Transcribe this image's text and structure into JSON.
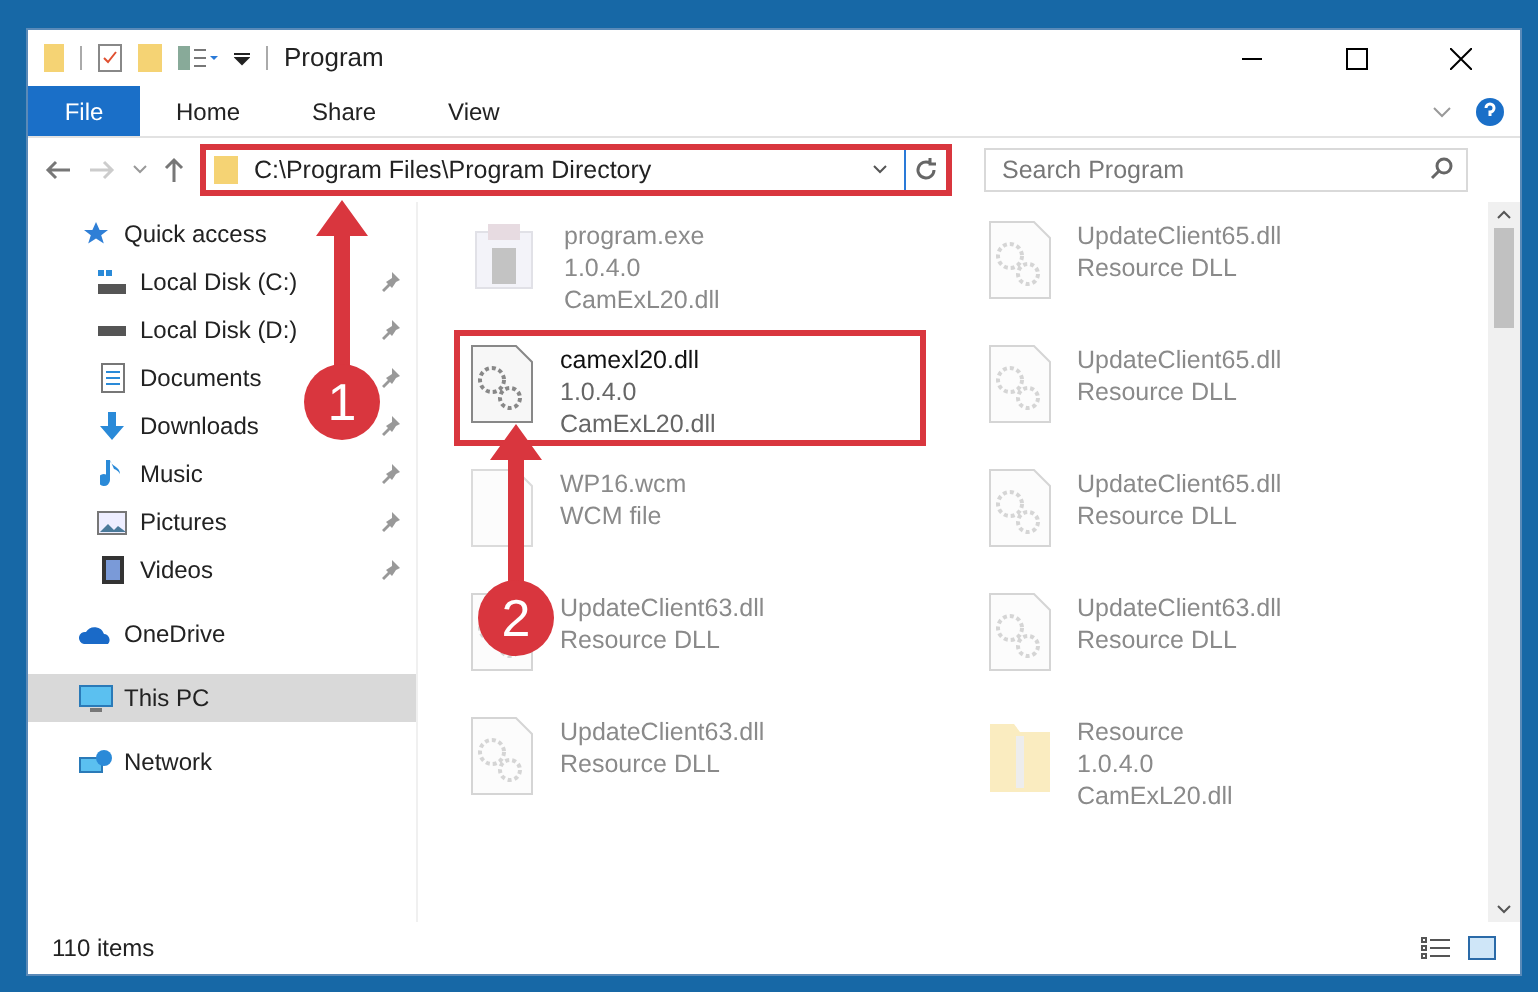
{
  "window": {
    "title": "Program"
  },
  "ribbon_tabs": [
    {
      "label": "File",
      "selected": true
    },
    {
      "label": "Home",
      "selected": false
    },
    {
      "label": "Share",
      "selected": false
    },
    {
      "label": "View",
      "selected": false
    }
  ],
  "address_bar": {
    "path": "C:\\Program Files\\Program Directory",
    "highlighted": true
  },
  "search": {
    "placeholder": "Search Program"
  },
  "sidebar": {
    "items": [
      {
        "label": "Quick access",
        "kind": "quick",
        "pinned": false,
        "selected": false,
        "children": [
          {
            "label": "Local Disk (C:)",
            "kind": "sysdisk",
            "pinned": true,
            "selected": false
          },
          {
            "label": "Local Disk (D:)",
            "kind": "disk",
            "pinned": true,
            "selected": false
          },
          {
            "label": "Documents",
            "kind": "documents",
            "pinned": true,
            "selected": false
          },
          {
            "label": "Downloads",
            "kind": "downloads",
            "pinned": true,
            "selected": false
          },
          {
            "label": "Music",
            "kind": "music",
            "pinned": true,
            "selected": false
          },
          {
            "label": "Pictures",
            "kind": "pictures",
            "pinned": true,
            "selected": false
          },
          {
            "label": "Videos",
            "kind": "videos",
            "pinned": true,
            "selected": false
          }
        ]
      },
      {
        "label": "OneDrive",
        "kind": "cloud",
        "pinned": false,
        "selected": false
      },
      {
        "label": "This PC",
        "kind": "pc",
        "pinned": false,
        "selected": true
      },
      {
        "label": "Network",
        "kind": "network",
        "pinned": false,
        "selected": false
      }
    ]
  },
  "files": [
    {
      "name": "program.exe",
      "lines": [
        "1.0.4.0",
        "CamExL20.dll"
      ],
      "kind": "exe",
      "blurred": true,
      "highlighted": false
    },
    {
      "name": "UpdateClient65.dll",
      "lines": [
        "Resource DLL"
      ],
      "kind": "dll",
      "blurred": true,
      "highlighted": false
    },
    {
      "name": "camexl20.dll",
      "lines": [
        "1.0.4.0",
        "CamExL20.dll"
      ],
      "kind": "dll",
      "blurred": false,
      "highlighted": true
    },
    {
      "name": "UpdateClient65.dll",
      "lines": [
        "Resource DLL"
      ],
      "kind": "dll",
      "blurred": true,
      "highlighted": false
    },
    {
      "name": "WP16.wcm",
      "lines": [
        "WCM file"
      ],
      "kind": "blank",
      "blurred": true,
      "highlighted": false
    },
    {
      "name": "UpdateClient65.dll",
      "lines": [
        "Resource DLL"
      ],
      "kind": "dll",
      "blurred": true,
      "highlighted": false
    },
    {
      "name": "UpdateClient63.dll",
      "lines": [
        "Resource DLL"
      ],
      "kind": "dll",
      "blurred": true,
      "highlighted": false
    },
    {
      "name": "UpdateClient63.dll",
      "lines": [
        "Resource DLL"
      ],
      "kind": "dll",
      "blurred": true,
      "highlighted": false
    },
    {
      "name": "UpdateClient63.dll",
      "lines": [
        "Resource DLL"
      ],
      "kind": "dll",
      "blurred": true,
      "highlighted": false
    },
    {
      "name": "Resource",
      "lines": [
        "1.0.4.0",
        "CamExL20.dll"
      ],
      "kind": "zip",
      "blurred": true,
      "highlighted": false
    }
  ],
  "status_bar": {
    "count": "110 items"
  },
  "annotations": [
    {
      "label": "1"
    },
    {
      "label": "2"
    }
  ]
}
